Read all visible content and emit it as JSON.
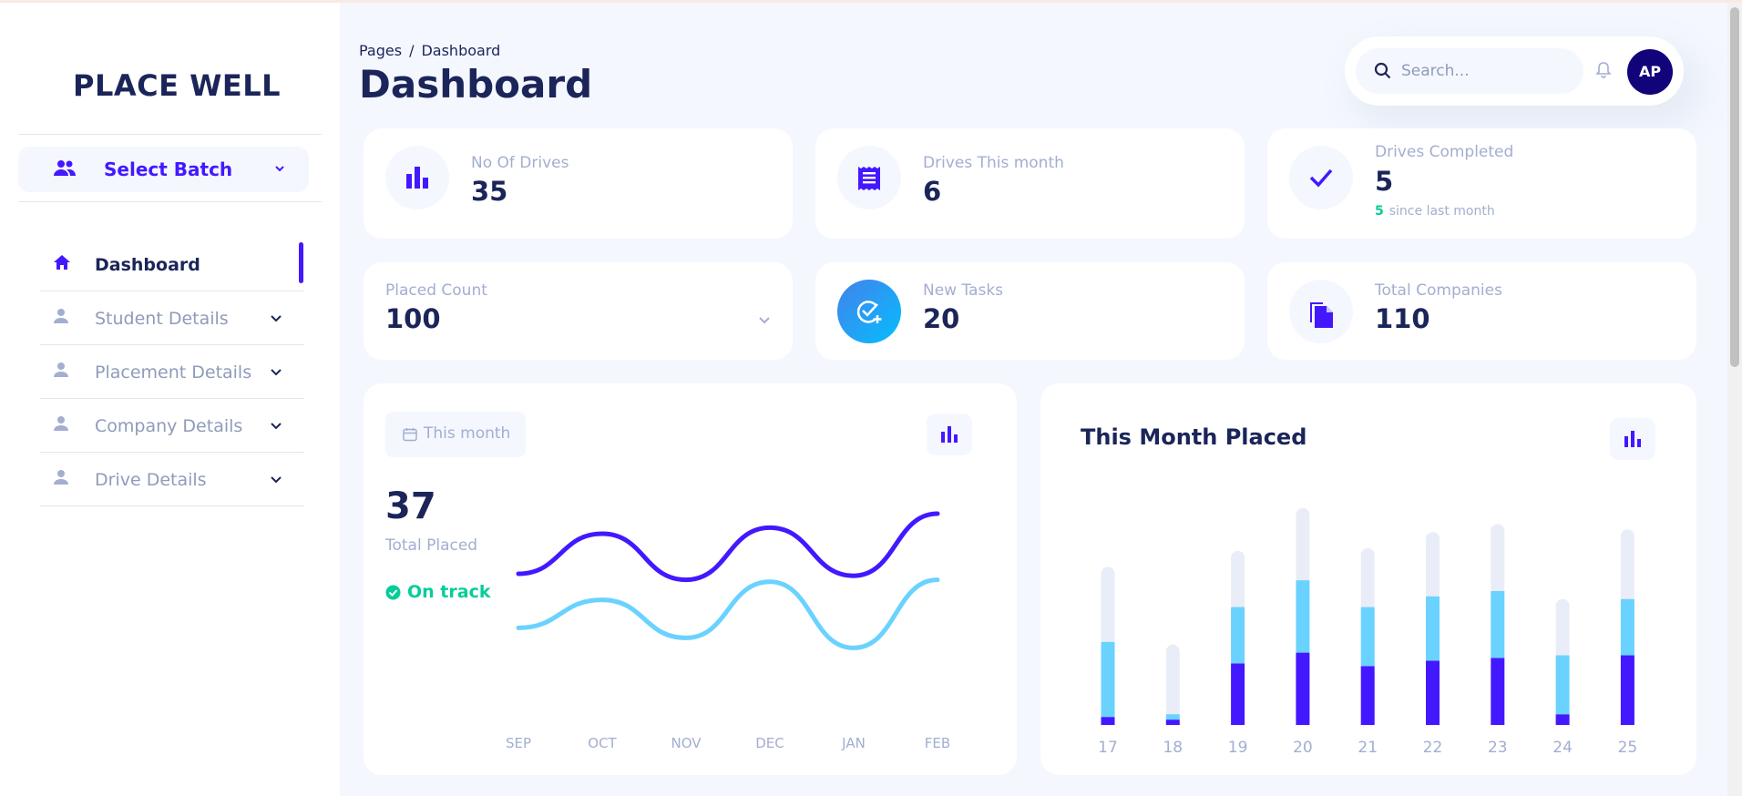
{
  "brand": "PLACE WELL",
  "batch_select": {
    "label": "Select Batch"
  },
  "nav": [
    {
      "label": "Dashboard",
      "active": true,
      "icon": "home-icon"
    },
    {
      "label": "Student Details",
      "icon": "person-icon"
    },
    {
      "label": "Placement Details",
      "icon": "person-icon"
    },
    {
      "label": "Company Details",
      "icon": "person-icon"
    },
    {
      "label": "Drive Details",
      "icon": "person-icon"
    }
  ],
  "breadcrumb": {
    "parent": "Pages",
    "separator": "/",
    "current": "Dashboard"
  },
  "page_title": "Dashboard",
  "search": {
    "placeholder": "Search..."
  },
  "user": {
    "initials": "AP"
  },
  "stats": {
    "drives": {
      "label": "No Of Drives",
      "value": "35"
    },
    "drives_month": {
      "label": "Drives This month",
      "value": "6"
    },
    "drives_completed": {
      "label": "Drives Completed",
      "value": "5",
      "delta": "5",
      "delta_text": "since last month"
    },
    "placed": {
      "label": "Placed Count",
      "value": "100"
    },
    "tasks": {
      "label": "New Tasks",
      "value": "20"
    },
    "companies": {
      "label": "Total Companies",
      "value": "110"
    }
  },
  "colors": {
    "accent": "#4318ff",
    "navy": "#1b2559",
    "green": "#05cd99",
    "muted": "#a3aed0",
    "cyan": "#6ad2ff"
  },
  "total_placed": {
    "period_button": "This month",
    "value": "37",
    "label": "Total Placed",
    "status": "On track"
  },
  "month_placed_title": "This Month Placed",
  "chart_data": [
    {
      "type": "line",
      "categories": [
        "SEP",
        "OCT",
        "NOV",
        "DEC",
        "JAN",
        "FEB"
      ],
      "series": [
        {
          "color": "#4318ff",
          "values": [
            55,
            75,
            52,
            78,
            54,
            85
          ]
        },
        {
          "color": "#6ad2ff",
          "values": [
            28,
            42,
            23,
            51,
            18,
            52
          ]
        }
      ],
      "ylim": [
        0,
        100
      ],
      "grid": false
    },
    {
      "type": "bar",
      "stacked": true,
      "categories": [
        "17",
        "18",
        "19",
        "20",
        "21",
        "22",
        "23",
        "24",
        "25"
      ],
      "series": [
        {
          "color": "#4318ff",
          "values": [
            3,
            2,
            23,
            27,
            22,
            24,
            25,
            4,
            26
          ]
        },
        {
          "color": "#6ad2ff",
          "values": [
            28,
            2,
            21,
            27,
            22,
            24,
            25,
            22,
            21
          ]
        },
        {
          "color": "#e9edf7",
          "values": [
            28,
            26,
            21,
            27,
            22,
            24,
            25,
            21,
            26
          ]
        }
      ],
      "ylim": [
        0,
        85
      ],
      "grid": false
    }
  ]
}
